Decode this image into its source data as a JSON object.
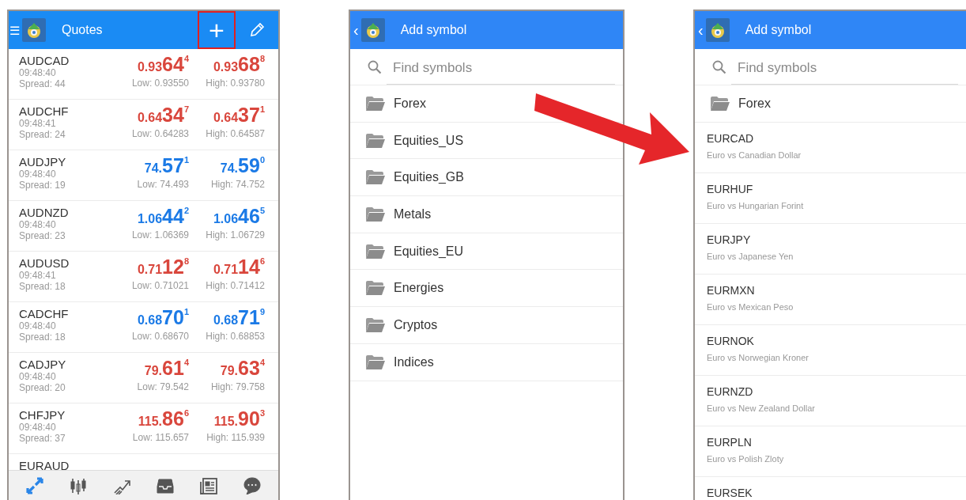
{
  "quotes_screen": {
    "menu_glyph": "☰",
    "title": "Quotes",
    "add_button": {
      "glyph": "+",
      "highlighted": true
    },
    "rows": [
      {
        "symbol": "AUDCAD",
        "time": "09:48:40",
        "spread": "Spread: 44",
        "color": "#d9463c",
        "bid": {
          "lead": "0.93",
          "big": "64",
          "sup": "4"
        },
        "ask": {
          "lead": "0.93",
          "big": "68",
          "sup": "8"
        },
        "low": "Low: 0.93550",
        "high": "High: 0.93780"
      },
      {
        "symbol": "AUDCHF",
        "time": "09:48:41",
        "spread": "Spread: 24",
        "color": "#d9463c",
        "bid": {
          "lead": "0.64",
          "big": "34",
          "sup": "7"
        },
        "ask": {
          "lead": "0.64",
          "big": "37",
          "sup": "1"
        },
        "low": "Low: 0.64283",
        "high": "High: 0.64587"
      },
      {
        "symbol": "AUDJPY",
        "time": "09:48:40",
        "spread": "Spread: 19",
        "color": "#1b7ae6",
        "bid": {
          "lead": "74.",
          "big": "57",
          "sup": "1"
        },
        "ask": {
          "lead": "74.",
          "big": "59",
          "sup": "0"
        },
        "low": "Low: 74.493",
        "high": "High: 74.752"
      },
      {
        "symbol": "AUDNZD",
        "time": "09:48:40",
        "spread": "Spread: 23",
        "color": "#1b7ae6",
        "bid": {
          "lead": "1.06",
          "big": "44",
          "sup": "2"
        },
        "ask": {
          "lead": "1.06",
          "big": "46",
          "sup": "5"
        },
        "low": "Low: 1.06369",
        "high": "High: 1.06729"
      },
      {
        "symbol": "AUDUSD",
        "time": "09:48:41",
        "spread": "Spread: 18",
        "color": "#d9463c",
        "bid": {
          "lead": "0.71",
          "big": "12",
          "sup": "8"
        },
        "ask": {
          "lead": "0.71",
          "big": "14",
          "sup": "6"
        },
        "low": "Low: 0.71021",
        "high": "High: 0.71412"
      },
      {
        "symbol": "CADCHF",
        "time": "09:48:40",
        "spread": "Spread: 18",
        "color": "#1b7ae6",
        "bid": {
          "lead": "0.68",
          "big": "70",
          "sup": "1"
        },
        "ask": {
          "lead": "0.68",
          "big": "71",
          "sup": "9"
        },
        "low": "Low: 0.68670",
        "high": "High: 0.68853"
      },
      {
        "symbol": "CADJPY",
        "time": "09:48:40",
        "spread": "Spread: 20",
        "color": "#d9463c",
        "bid": {
          "lead": "79.",
          "big": "61",
          "sup": "4"
        },
        "ask": {
          "lead": "79.",
          "big": "63",
          "sup": "4"
        },
        "low": "Low: 79.542",
        "high": "High: 79.758"
      },
      {
        "symbol": "CHFJPY",
        "time": "09:48:40",
        "spread": "Spread: 37",
        "color": "#d9463c",
        "bid": {
          "lead": "115.",
          "big": "86",
          "sup": "6"
        },
        "ask": {
          "lead": "115.",
          "big": "90",
          "sup": "3"
        },
        "low": "Low: 115.657",
        "high": "High: 115.939"
      },
      {
        "symbol": "EURAUD"
      }
    ],
    "bottom_tabs": [
      {
        "kind": "quotes",
        "selected": true
      },
      {
        "kind": "chart",
        "selected": false
      },
      {
        "kind": "trade",
        "selected": false
      },
      {
        "kind": "history",
        "selected": false
      },
      {
        "kind": "news",
        "selected": false
      },
      {
        "kind": "chat",
        "selected": false
      }
    ]
  },
  "add_symbol_screen": {
    "back_glyph": "‹",
    "title": "Add symbol",
    "search": {
      "placeholder": "Find symbols"
    },
    "folders": [
      "Forex",
      "Equities_US",
      "Equities_GB",
      "Metals",
      "Equities_EU",
      "Energies",
      "Cryptos",
      "Indices"
    ]
  },
  "forex_screen": {
    "back_glyph": "‹",
    "title": "Add symbol",
    "search": {
      "placeholder": "Find symbols"
    },
    "folder": "Forex",
    "symbols": [
      {
        "name": "EURCAD",
        "description": "Euro vs Canadian Dollar"
      },
      {
        "name": "EURHUF",
        "description": "Euro vs Hungarian Forint"
      },
      {
        "name": "EURJPY",
        "description": "Euro vs Japanese Yen"
      },
      {
        "name": "EURMXN",
        "description": "Euro vs Mexican Peso"
      },
      {
        "name": "EURNOK",
        "description": "Euro vs Norwegian Kroner"
      },
      {
        "name": "EURNZD",
        "description": "Euro vs New Zealand Dollar"
      },
      {
        "name": "EURPLN",
        "description": "Euro vs Polish Zloty"
      },
      {
        "name": "EURSEK"
      }
    ]
  }
}
